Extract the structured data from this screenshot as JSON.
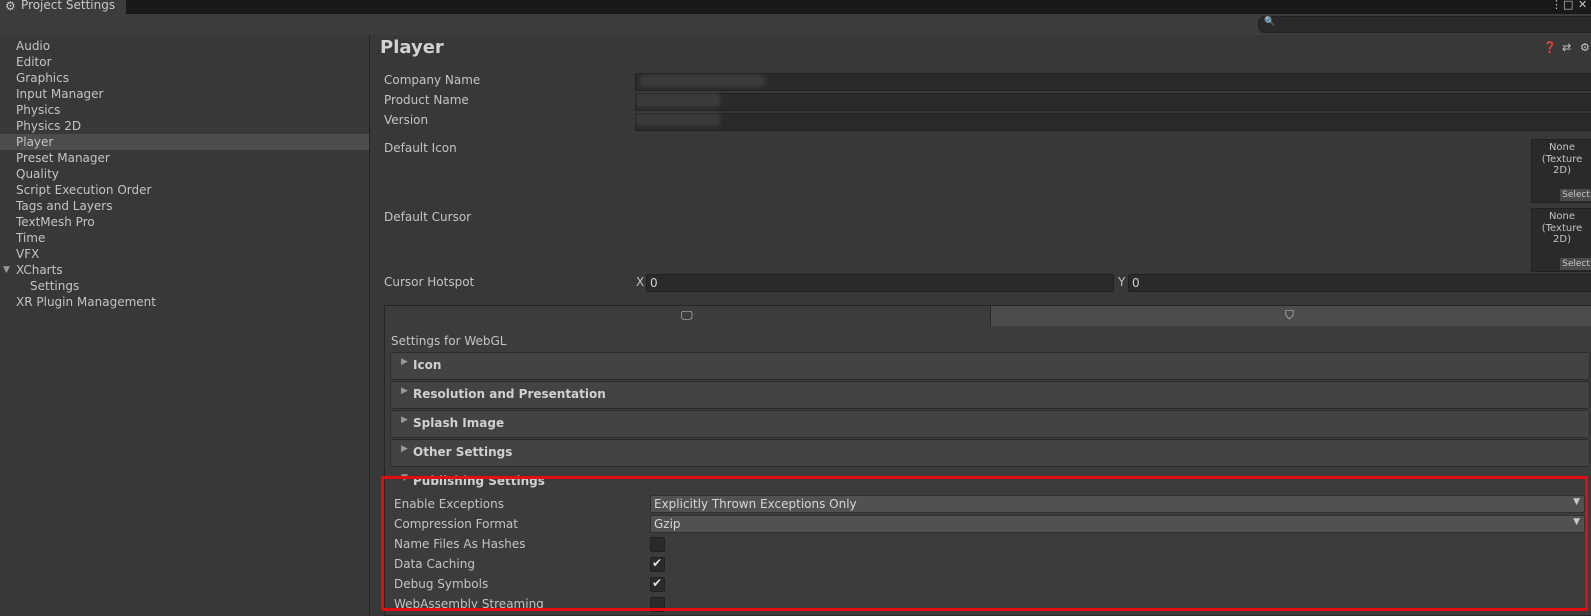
{
  "window": {
    "title": "Project Settings",
    "controls": [
      "⋮",
      "□",
      "✕"
    ]
  },
  "sidebar": {
    "items": [
      {
        "label": "Audio"
      },
      {
        "label": "Editor"
      },
      {
        "label": "Graphics"
      },
      {
        "label": "Input Manager"
      },
      {
        "label": "Physics"
      },
      {
        "label": "Physics 2D"
      },
      {
        "label": "Player",
        "selected": true
      },
      {
        "label": "Preset Manager"
      },
      {
        "label": "Quality"
      },
      {
        "label": "Script Execution Order"
      },
      {
        "label": "Tags and Layers"
      },
      {
        "label": "TextMesh Pro"
      },
      {
        "label": "Time"
      },
      {
        "label": "VFX"
      },
      {
        "label": "XCharts",
        "expanded": true
      },
      {
        "label": "Settings",
        "child": true
      },
      {
        "label": "XR Plugin Management"
      }
    ]
  },
  "header": {
    "title": "Player",
    "icons": [
      "help-icon",
      "preset-icon",
      "settings-icon"
    ]
  },
  "fields": {
    "company_name_label": "Company Name",
    "product_name_label": "Product Name",
    "version_label": "Version",
    "default_icon_label": "Default Icon",
    "default_cursor_label": "Default Cursor",
    "cursor_hotspot_label": "Cursor Hotspot",
    "none_label": "None",
    "texture_label": "(Texture 2D)",
    "select_label": "Select",
    "x_label": "X",
    "y_label": "Y",
    "x_value": "0",
    "y_value": "0"
  },
  "platform": {
    "tabs": [
      {
        "icon": "monitor-icon",
        "active": false
      },
      {
        "icon": "html5-icon",
        "active": true
      }
    ],
    "settings_title": "Settings for WebGL"
  },
  "sections": [
    {
      "title": "Icon",
      "expanded": false
    },
    {
      "title": "Resolution and Presentation",
      "expanded": false
    },
    {
      "title": "Splash Image",
      "expanded": false
    },
    {
      "title": "Other Settings",
      "expanded": false
    },
    {
      "title": "Publishing Settings",
      "expanded": true
    }
  ],
  "publishing": {
    "enable_exceptions_label": "Enable Exceptions",
    "enable_exceptions_value": "Explicitly Thrown Exceptions Only",
    "compression_format_label": "Compression Format",
    "compression_format_value": "Gzip",
    "name_files_label": "Name Files As Hashes",
    "name_files_checked": false,
    "data_caching_label": "Data Caching",
    "data_caching_checked": true,
    "debug_symbols_label": "Debug Symbols",
    "debug_symbols_checked": true,
    "wasm_streaming_label": "WebAssembly Streaming",
    "wasm_streaming_checked": false
  },
  "colors": {
    "highlight": "#e00d12",
    "background": "#383838",
    "selected": "#4d4d4d"
  }
}
